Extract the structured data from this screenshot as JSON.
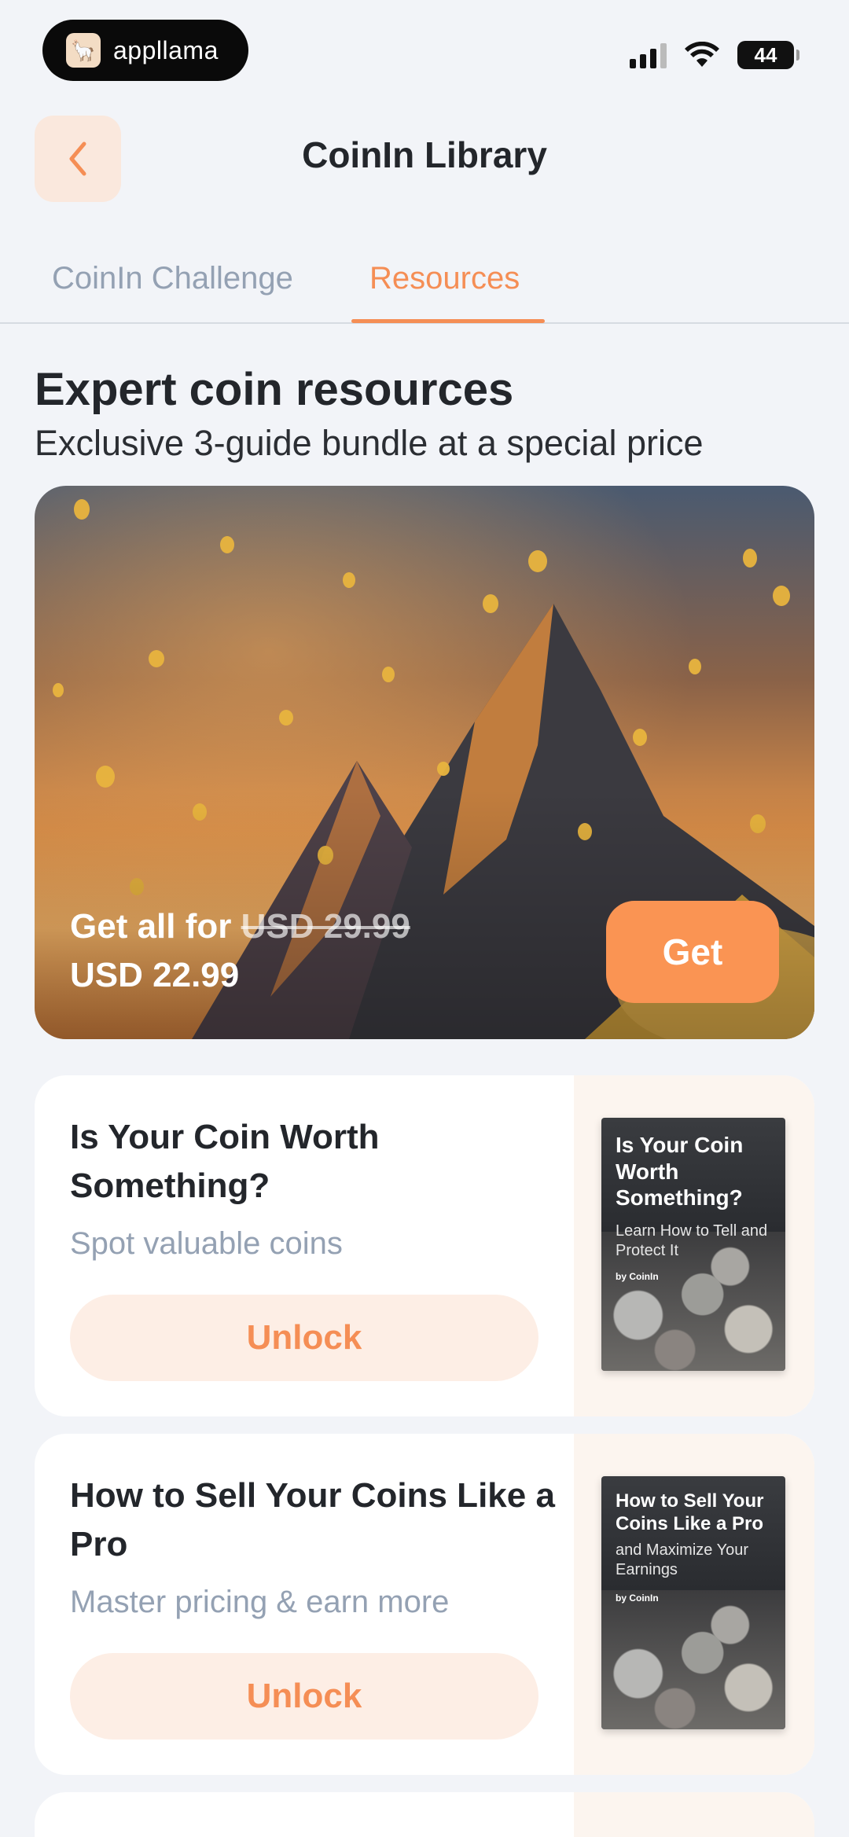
{
  "status_bar": {
    "app_badge": "appllama",
    "battery": "44"
  },
  "header": {
    "title": "CoinIn Library",
    "back_icon": "chevron-left-icon"
  },
  "tabs": [
    {
      "label": "CoinIn Challenge",
      "active": false
    },
    {
      "label": "Resources",
      "active": true
    }
  ],
  "section": {
    "title": "Expert coin resources",
    "subtitle": "Exclusive 3-guide bundle at a special price"
  },
  "bundle": {
    "prefix": "Get all for",
    "old_price": "USD 29.99",
    "new_price": "USD 22.99",
    "button_label": "Get"
  },
  "guides": [
    {
      "title": "Is Your Coin Worth Something?",
      "subtitle": "Spot valuable coins",
      "button_label": "Unlock",
      "cover_title": "Is Your Coin Worth Something?",
      "cover_subtitle": "Learn How to Tell and Protect It",
      "cover_brand": "by CoinIn"
    },
    {
      "title": "How to Sell Your Coins Like a Pro",
      "subtitle": "Master pricing & earn more",
      "button_label": "Unlock",
      "cover_title": "How to Sell Your Coins Like a Pro",
      "cover_subtitle": "and Maximize Your Earnings",
      "cover_brand": "by CoinIn"
    }
  ],
  "colors": {
    "accent": "#f58e55",
    "background": "#f2f4f8",
    "muted_text": "#94a1b3"
  }
}
